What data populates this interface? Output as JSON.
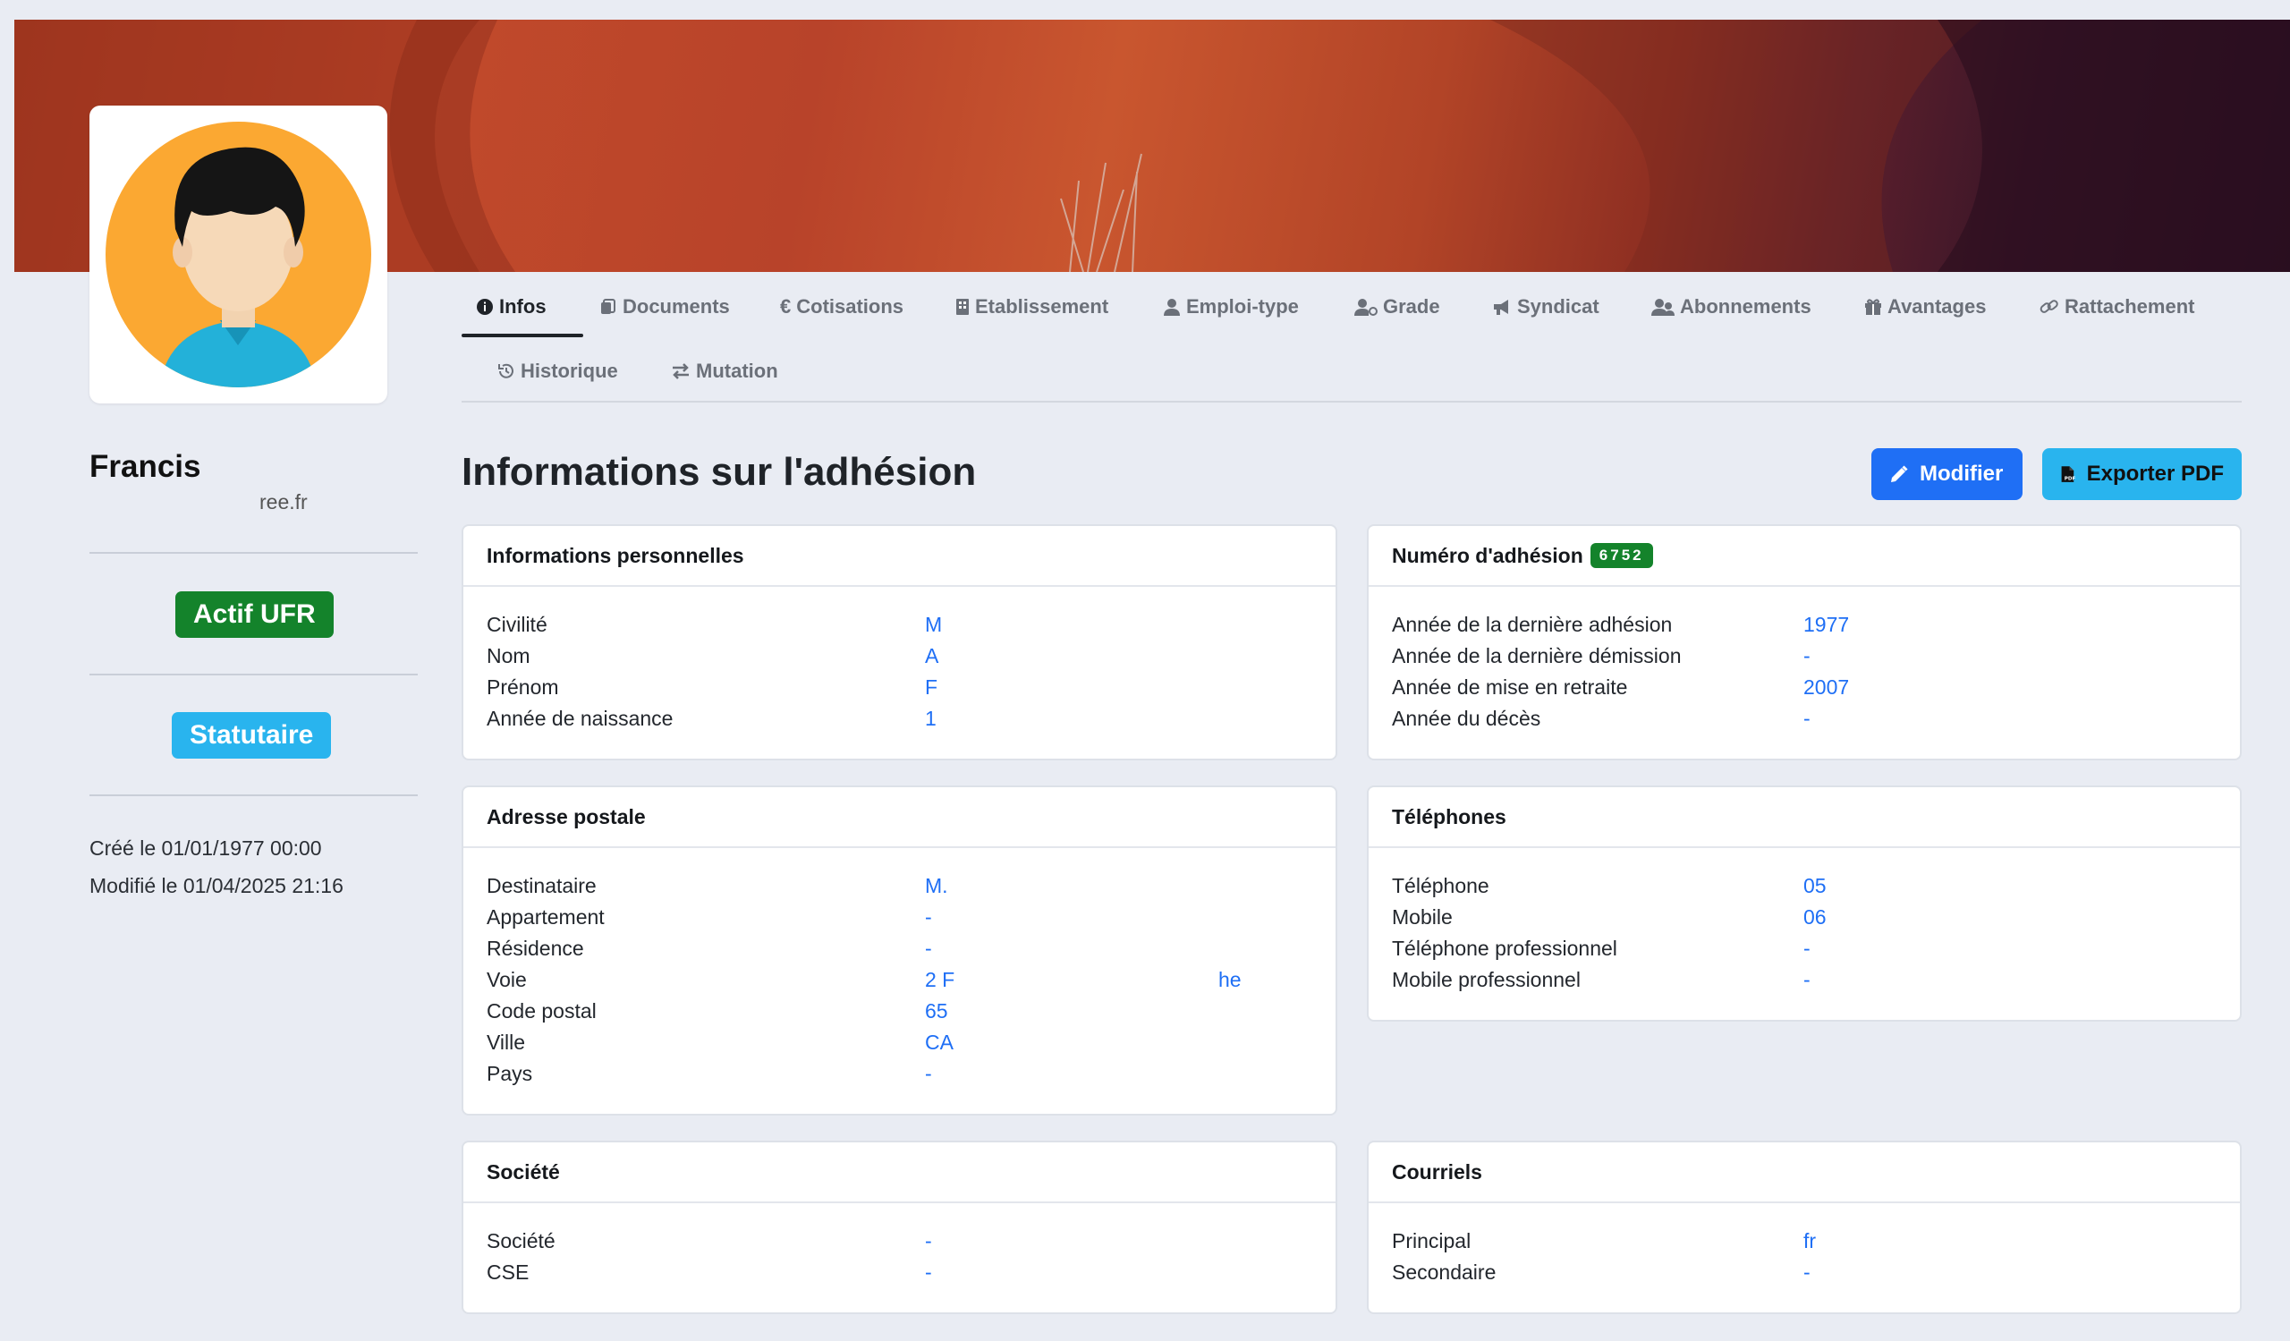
{
  "profile": {
    "name": "Francis",
    "email": "ree.fr",
    "status_badge": "Actif UFR",
    "type_badge": "Statutaire",
    "created": "Créé le 01/01/1977 00:00",
    "modified": "Modifié le 01/04/2025 21:16"
  },
  "tabs": [
    {
      "label": "Infos",
      "icon": "info-icon"
    },
    {
      "label": "Documents",
      "icon": "documents-icon"
    },
    {
      "label": "Cotisations",
      "icon": "euro-icon"
    },
    {
      "label": "Etablissement",
      "icon": "building-icon"
    },
    {
      "label": "Emploi-type",
      "icon": "user-icon"
    },
    {
      "label": "Grade",
      "icon": "user-grade-icon"
    },
    {
      "label": "Syndicat",
      "icon": "megaphone-icon"
    },
    {
      "label": "Abonnements",
      "icon": "users-icon"
    },
    {
      "label": "Avantages",
      "icon": "gift-icon"
    },
    {
      "label": "Rattachement",
      "icon": "link-icon"
    },
    {
      "label": "Historique",
      "icon": "history-icon"
    },
    {
      "label": "Mutation",
      "icon": "swap-icon"
    }
  ],
  "header": {
    "title": "Informations sur l'adhésion",
    "modifier_label": "Modifier",
    "export_label": "Exporter PDF"
  },
  "cards": {
    "personnelles": {
      "title": "Informations personnelles",
      "rows": [
        {
          "label": "Civilité",
          "value": "M"
        },
        {
          "label": "Nom",
          "value": "A"
        },
        {
          "label": "Prénom",
          "value": "F"
        },
        {
          "label": "Année de naissance",
          "value": "1"
        }
      ]
    },
    "adhesion": {
      "title": "Numéro d'adhésion",
      "number": "6752",
      "rows": [
        {
          "label": "Année de la dernière adhésion",
          "value": "1977"
        },
        {
          "label": "Année de la dernière démission",
          "value": "-"
        },
        {
          "label": "Année de mise en retraite",
          "value": "2007"
        },
        {
          "label": "Année du décès",
          "value": "-"
        }
      ]
    },
    "adresse": {
      "title": "Adresse postale",
      "rows": [
        {
          "label": "Destinataire",
          "value": "M."
        },
        {
          "label": "Appartement",
          "value": "-"
        },
        {
          "label": "Résidence",
          "value": "-"
        },
        {
          "label": "Voie",
          "value": "2 F",
          "extra": "he"
        },
        {
          "label": "Code postal",
          "value": "65"
        },
        {
          "label": "Ville",
          "value": "CA"
        },
        {
          "label": "Pays",
          "value": "-"
        }
      ]
    },
    "telephones": {
      "title": "Téléphones",
      "rows": [
        {
          "label": "Téléphone",
          "value": "05"
        },
        {
          "label": "Mobile",
          "value": "06"
        },
        {
          "label": "Téléphone professionnel",
          "value": "-"
        },
        {
          "label": "Mobile professionnel",
          "value": "-"
        }
      ]
    },
    "societe": {
      "title": "Société",
      "rows": [
        {
          "label": "Société",
          "value": "-"
        },
        {
          "label": "CSE",
          "value": "-"
        }
      ]
    },
    "courriels": {
      "title": "Courriels",
      "rows": [
        {
          "label": "Principal",
          "value": "fr"
        },
        {
          "label": "Secondaire",
          "value": "-"
        }
      ]
    }
  },
  "colors": {
    "primary": "#1f6ff5",
    "info": "#29b4ee",
    "success": "#14832b",
    "background": "#e9ecf3"
  }
}
